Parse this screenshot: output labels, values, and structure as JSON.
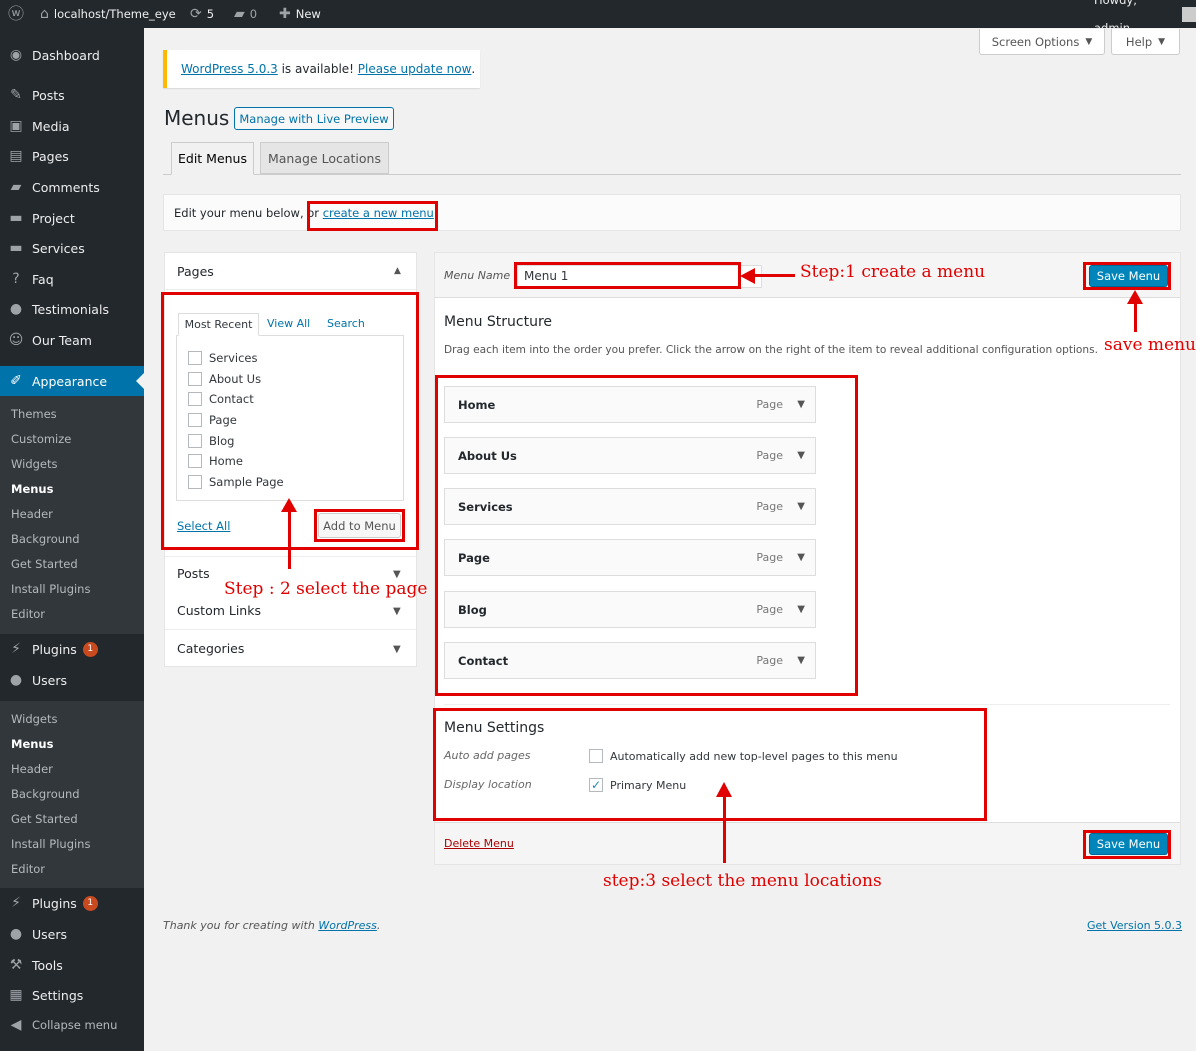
{
  "adminbar": {
    "site": "localhost/Theme_eye",
    "updates": "5",
    "comments": "0",
    "new": "New",
    "howdy": "Howdy, admin"
  },
  "sidebar": {
    "dashboard": "Dashboard",
    "posts": "Posts",
    "media": "Media",
    "pages": "Pages",
    "comments": "Comments",
    "project": "Project",
    "services": "Services",
    "faq": "Faq",
    "testimonials": "Testimonials",
    "our_team": "Our Team",
    "appearance": "Appearance",
    "sub1": [
      "Themes",
      "Customize",
      "Widgets",
      "Menus",
      "Header",
      "Background",
      "Get Started",
      "Install Plugins",
      "Editor"
    ],
    "plugins": "Plugins",
    "plugins_badge": "1",
    "users": "Users",
    "sub2": [
      "Widgets",
      "Menus",
      "Header",
      "Background",
      "Get Started",
      "Install Plugins",
      "Editor"
    ],
    "plugins2": "Plugins",
    "plugins2_badge": "1",
    "users2": "Users",
    "tools": "Tools",
    "settings": "Settings",
    "collapse": "Collapse menu"
  },
  "header": {
    "screen_options": "Screen Options",
    "help": "Help"
  },
  "notice": {
    "version_link": "WordPress 5.0.3",
    "middle": " is available! ",
    "update_link": "Please update now",
    "end": "."
  },
  "page": {
    "title": "Menus",
    "live_preview": "Manage with Live Preview",
    "tab_edit": "Edit Menus",
    "tab_locations": "Manage Locations",
    "edit_text": "Edit your menu below, or ",
    "create_link": "create a new menu",
    "dot": "."
  },
  "pages_box": {
    "title": "Pages",
    "tabs": [
      "Most Recent",
      "View All",
      "Search"
    ],
    "items": [
      "Services",
      "About Us",
      "Contact",
      "Page",
      "Blog",
      "Home",
      "Sample Page"
    ],
    "select_all": "Select All",
    "add": "Add to Menu"
  },
  "accordion": {
    "posts": "Posts",
    "custom_links": "Custom Links",
    "categories": "Categories"
  },
  "menu": {
    "name_label": "Menu Name",
    "name_value": "Menu 1",
    "save": "Save Menu",
    "structure_title": "Menu Structure",
    "structure_desc": "Drag each item into the order you prefer. Click the arrow on the right of the item to reveal additional configuration options.",
    "items": [
      {
        "label": "Home",
        "type": "Page"
      },
      {
        "label": "About Us",
        "type": "Page"
      },
      {
        "label": "Services",
        "type": "Page"
      },
      {
        "label": "Page",
        "type": "Page"
      },
      {
        "label": "Blog",
        "type": "Page"
      },
      {
        "label": "Contact",
        "type": "Page"
      }
    ],
    "settings_title": "Menu Settings",
    "auto_label": "Auto add pages",
    "auto_text": "Automatically add new top-level pages to this menu",
    "display_label": "Display location",
    "primary": "Primary Menu",
    "delete": "Delete Menu"
  },
  "annotations": {
    "step1": "Step:1 create a menu",
    "save_menu": "save menu",
    "step2": "Step : 2 select the page",
    "step3": "step:3 select the menu locations"
  },
  "footer": {
    "thanks": "Thank you for creating with ",
    "wp": "WordPress",
    "dot": ".",
    "version": "Get Version 5.0.3"
  },
  "colors": {
    "accent": "#0073aa",
    "annotation": "#e00000",
    "sidebar": "#23282d"
  }
}
